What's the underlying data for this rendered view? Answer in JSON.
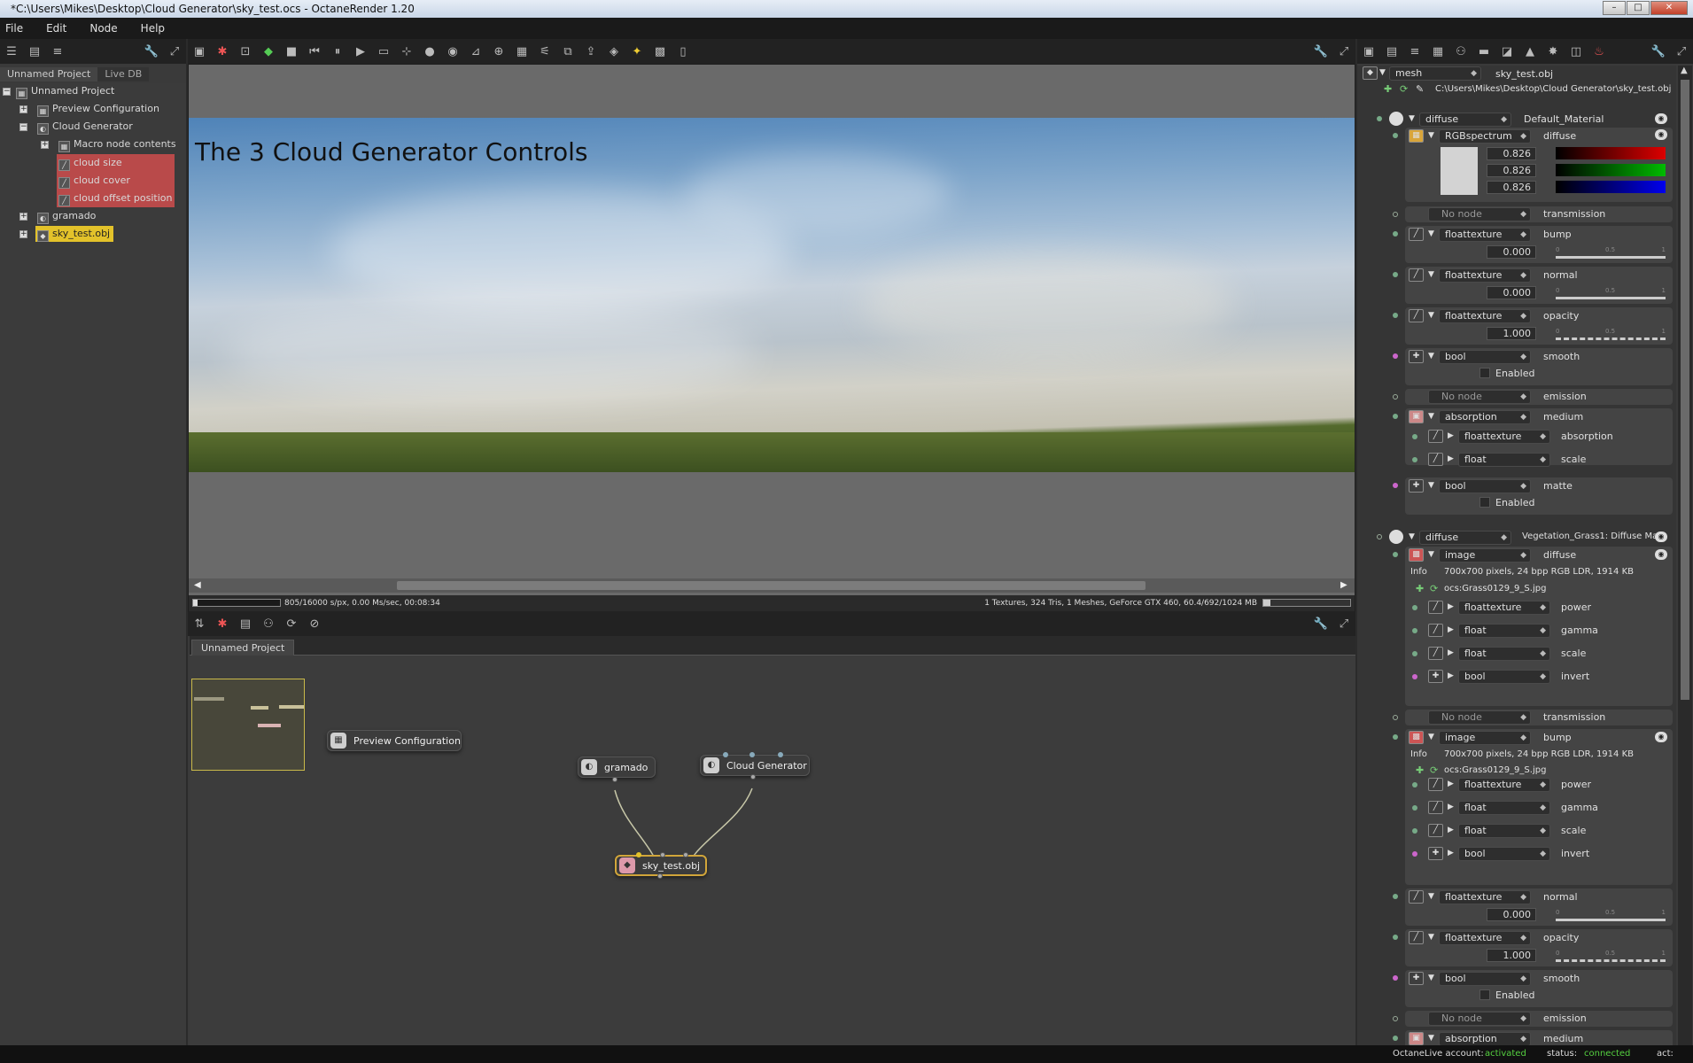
{
  "window": {
    "title": "*C:\\Users\\Mikes\\Desktop\\Cloud Generator\\sky_test.ocs - OctaneRender 1.20",
    "controls": [
      "–",
      "□",
      "✕"
    ]
  },
  "menu": [
    "File",
    "Edit",
    "Node",
    "Help"
  ],
  "outliner": {
    "tabs": [
      "Unnamed Project",
      "Live DB"
    ],
    "items": [
      {
        "label": "Unnamed Project",
        "level": 0,
        "expander": "−"
      },
      {
        "label": "Preview Configuration",
        "level": 1,
        "expander": "+"
      },
      {
        "label": "Cloud Generator",
        "level": 1,
        "expander": "−"
      },
      {
        "label": "Macro node contents",
        "level": 2,
        "expander": "+"
      },
      {
        "label": "cloud size",
        "level": 3,
        "highlight": "red"
      },
      {
        "label": "cloud cover",
        "level": 3,
        "highlight": "red"
      },
      {
        "label": "cloud offset position",
        "level": 3,
        "highlight": "red"
      },
      {
        "label": "gramado",
        "level": 1,
        "expander": "+"
      },
      {
        "label": "sky_test.obj",
        "level": 1,
        "expander": "+",
        "highlight": "yellow"
      }
    ]
  },
  "viewport": {
    "overlay_text": "The 3 Cloud Generator Controls",
    "status_left": "805/16000 s/px, 0.00 Ms/sec, 00:08:34",
    "status_right": "1 Textures, 324 Tris, 1 Meshes, GeForce GTX 460, 60.4/692/1024 MB",
    "render_progress": 0.05
  },
  "graph": {
    "tab": "Unnamed Project",
    "nodes": {
      "preview": "Preview Configuration",
      "gramado": "gramado",
      "cloud": "Cloud Generator",
      "sky": "sky_test.obj"
    }
  },
  "inspector": {
    "header": {
      "type": "mesh",
      "name": "sky_test.obj",
      "path": "C:\\Users\\Mikes\\Desktop\\Cloud Generator\\sky_test.obj"
    },
    "material1": {
      "type": "diffuse",
      "name": "Default_Material"
    },
    "material2": {
      "type": "diffuse",
      "name": "Vegetation_Grass1: Diffuse Ma..."
    },
    "rows": {
      "rgb_type": "RGBspectrum",
      "rgb_label": "diffuse",
      "rgb_r": "0.826",
      "rgb_g": "0.826",
      "rgb_b": "0.826",
      "no_node": "No node",
      "transmission": "transmission",
      "floattexture": "floattexture",
      "bump": "bump",
      "bump_val": "0.000",
      "normal": "normal",
      "normal_val": "0.000",
      "opacity": "opacity",
      "opacity_val": "1.000",
      "bool": "bool",
      "smooth": "smooth",
      "enabled": "Enabled",
      "emission": "emission",
      "absorption": "absorption",
      "medium": "medium",
      "float": "float",
      "scale": "scale",
      "matte": "matte",
      "image": "image",
      "diffuse": "diffuse",
      "info": "Info",
      "img_info": "700x700 pixels, 24 bpp RGB LDR, 1914 KB",
      "img_file": "ocs:Grass0129_9_S.jpg",
      "power": "power",
      "gamma": "gamma",
      "invert": "invert",
      "tick0": "0",
      "tick05": "0.5",
      "tick1": "1"
    },
    "footer": {
      "account_label": "OctaneLive account:",
      "account_value": "activated",
      "status_label": "status:",
      "status_value": "connected",
      "act_label": "act:"
    }
  },
  "colors": {
    "selected_red": "#b94a4a",
    "selected_yellow": "#e3c22a",
    "status_green": "#55d040"
  }
}
